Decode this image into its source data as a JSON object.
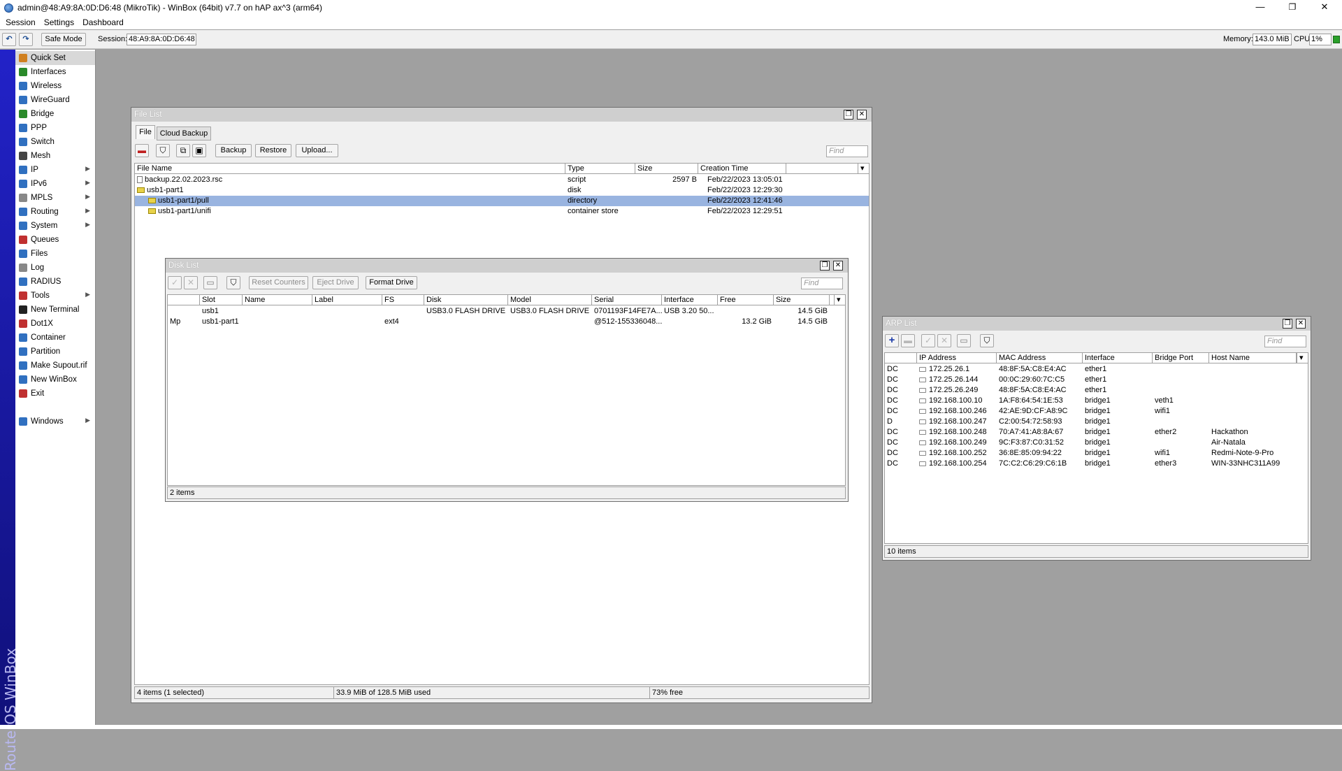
{
  "app": {
    "title": "admin@48:A9:8A:0D:D6:48 (MikroTik) - WinBox (64bit) v7.7 on hAP ax^3 (arm64)",
    "brand": "RouterOS WinBox",
    "window_controls": {
      "minimize": "—",
      "maximize": "❐",
      "close": "✕"
    }
  },
  "menu": [
    "Session",
    "Settings",
    "Dashboard"
  ],
  "toolbar": {
    "undo_icon": "↶",
    "redo_icon": "↷",
    "safe_mode": "Safe Mode",
    "session_label": "Session:",
    "session_value": "48:A9:8A:0D:D6:48",
    "memory_label": "Memory:",
    "memory_value": "143.0 MiB",
    "cpu_label": "CPU:",
    "cpu_value": "1%",
    "status_color": "#2aa02a"
  },
  "sidebar": {
    "items": [
      {
        "label": "Quick Set",
        "icon": "quickset-icon",
        "color": "#d08020",
        "submenu": false
      },
      {
        "label": "Interfaces",
        "icon": "interfaces-icon",
        "color": "#2a8a2a",
        "submenu": false
      },
      {
        "label": "Wireless",
        "icon": "wireless-icon",
        "color": "#3070c0",
        "submenu": false
      },
      {
        "label": "WireGuard",
        "icon": "wireguard-icon",
        "color": "#3070c0",
        "submenu": false
      },
      {
        "label": "Bridge",
        "icon": "bridge-icon",
        "color": "#2a8a2a",
        "submenu": false
      },
      {
        "label": "PPP",
        "icon": "ppp-icon",
        "color": "#3070c0",
        "submenu": false
      },
      {
        "label": "Switch",
        "icon": "switch-icon",
        "color": "#3070c0",
        "submenu": false
      },
      {
        "label": "Mesh",
        "icon": "mesh-icon",
        "color": "#444444",
        "submenu": false
      },
      {
        "label": "IP",
        "icon": "ip-icon",
        "color": "#3070c0",
        "submenu": true
      },
      {
        "label": "IPv6",
        "icon": "ipv6-icon",
        "color": "#3070c0",
        "submenu": true
      },
      {
        "label": "MPLS",
        "icon": "mpls-icon",
        "color": "#888888",
        "submenu": true
      },
      {
        "label": "Routing",
        "icon": "routing-icon",
        "color": "#3070c0",
        "submenu": true
      },
      {
        "label": "System",
        "icon": "system-icon",
        "color": "#3070c0",
        "submenu": true
      },
      {
        "label": "Queues",
        "icon": "queues-icon",
        "color": "#c03030",
        "submenu": false
      },
      {
        "label": "Files",
        "icon": "files-icon",
        "color": "#3070c0",
        "submenu": false
      },
      {
        "label": "Log",
        "icon": "log-icon",
        "color": "#888888",
        "submenu": false
      },
      {
        "label": "RADIUS",
        "icon": "radius-icon",
        "color": "#3070c0",
        "submenu": false
      },
      {
        "label": "Tools",
        "icon": "tools-icon",
        "color": "#c03030",
        "submenu": true
      },
      {
        "label": "New Terminal",
        "icon": "terminal-icon",
        "color": "#222222",
        "submenu": false
      },
      {
        "label": "Dot1X",
        "icon": "dot1x-icon",
        "color": "#c03030",
        "submenu": false
      },
      {
        "label": "Container",
        "icon": "container-icon",
        "color": "#3070c0",
        "submenu": false
      },
      {
        "label": "Partition",
        "icon": "partition-icon",
        "color": "#3070c0",
        "submenu": false
      },
      {
        "label": "Make Supout.rif",
        "icon": "supout-icon",
        "color": "#3070c0",
        "submenu": false
      },
      {
        "label": "New WinBox",
        "icon": "winbox-icon",
        "color": "#3070c0",
        "submenu": false
      },
      {
        "label": "Exit",
        "icon": "exit-icon",
        "color": "#c03030",
        "submenu": false
      }
    ],
    "windows": {
      "label": "Windows",
      "icon": "windows-icon",
      "color": "#3070c0",
      "submenu": true
    }
  },
  "file_list": {
    "title": "File List",
    "tabs": [
      "File",
      "Cloud Backup"
    ],
    "buttons": [
      "Backup",
      "Restore",
      "Upload..."
    ],
    "find_placeholder": "Find",
    "columns": [
      "File Name",
      "Type",
      "Size",
      "Creation Time"
    ],
    "rows": [
      {
        "name": "backup.22.02.2023.rsc",
        "type": "script",
        "size": "2597 B",
        "time": "Feb/22/2023 13:05:01",
        "icon": "file-icon",
        "indent": 0,
        "selected": false
      },
      {
        "name": "usb1-part1",
        "type": "disk",
        "size": "",
        "time": "Feb/22/2023 12:29:30",
        "icon": "folder-icon",
        "indent": 0,
        "selected": false
      },
      {
        "name": "usb1-part1/pull",
        "type": "directory",
        "size": "",
        "time": "Feb/22/2023 12:41:46",
        "icon": "folder-icon",
        "indent": 1,
        "selected": true
      },
      {
        "name": "usb1-part1/unifi",
        "type": "container store",
        "size": "",
        "time": "Feb/22/2023 12:29:51",
        "icon": "folder-icon",
        "indent": 1,
        "selected": false
      }
    ],
    "status": [
      "4 items (1 selected)",
      "33.9 MiB of 128.5 MiB used",
      "73% free"
    ]
  },
  "disk_list": {
    "title": "Disk List",
    "buttons": [
      "Reset Counters",
      "Eject Drive",
      "Format Drive"
    ],
    "find_placeholder": "Find",
    "columns": [
      "",
      "Slot",
      "Name",
      "Label",
      "FS",
      "Disk",
      "Model",
      "Serial",
      "Interface",
      "Free",
      "Size"
    ],
    "rows": [
      [
        "",
        "usb1",
        "",
        "",
        "",
        "USB3.0 FLASH DRIVE",
        "USB3.0 FLASH DRIVE",
        "0701193F14FE7A...",
        "USB 3.20 50...",
        "",
        "14.5 GiB"
      ],
      [
        "Mp",
        "usb1-part1",
        "",
        "",
        "ext4",
        "",
        "",
        "@512-155336048...",
        "",
        "13.2 GiB",
        "14.5 GiB"
      ]
    ],
    "status": "2 items"
  },
  "arp_list": {
    "title": "ARP List",
    "find_placeholder": "Find",
    "columns": [
      "",
      "IP Address",
      "MAC Address",
      "Interface",
      "Bridge Port",
      "Host Name"
    ],
    "rows": [
      [
        "DC",
        "172.25.26.1",
        "48:8F:5A:C8:E4:AC",
        "ether1",
        "",
        ""
      ],
      [
        "DC",
        "172.25.26.144",
        "00:0C:29:60:7C:C5",
        "ether1",
        "",
        ""
      ],
      [
        "DC",
        "172.25.26.249",
        "48:8F:5A:C8:E4:AC",
        "ether1",
        "",
        ""
      ],
      [
        "DC",
        "192.168.100.10",
        "1A:F8:64:54:1E:53",
        "bridge1",
        "veth1",
        ""
      ],
      [
        "DC",
        "192.168.100.246",
        "42:AE:9D:CF:A8:9C",
        "bridge1",
        "wifi1",
        ""
      ],
      [
        "D",
        "192.168.100.247",
        "C2:00:54:72:58:93",
        "bridge1",
        "",
        ""
      ],
      [
        "DC",
        "192.168.100.248",
        "70:A7:41:A8:8A:67",
        "bridge1",
        "ether2",
        "Hackathon"
      ],
      [
        "DC",
        "192.168.100.249",
        "9C:F3:87:C0:31:52",
        "bridge1",
        "",
        "Air-Natala"
      ],
      [
        "DC",
        "192.168.100.252",
        "36:8E:85:09:94:22",
        "bridge1",
        "wifi1",
        "Redmi-Note-9-Pro"
      ],
      [
        "DC",
        "192.168.100.254",
        "7C:C2:C6:29:C6:1B",
        "bridge1",
        "ether3",
        "WIN-33NHC311A99"
      ]
    ],
    "status": "10 items"
  }
}
